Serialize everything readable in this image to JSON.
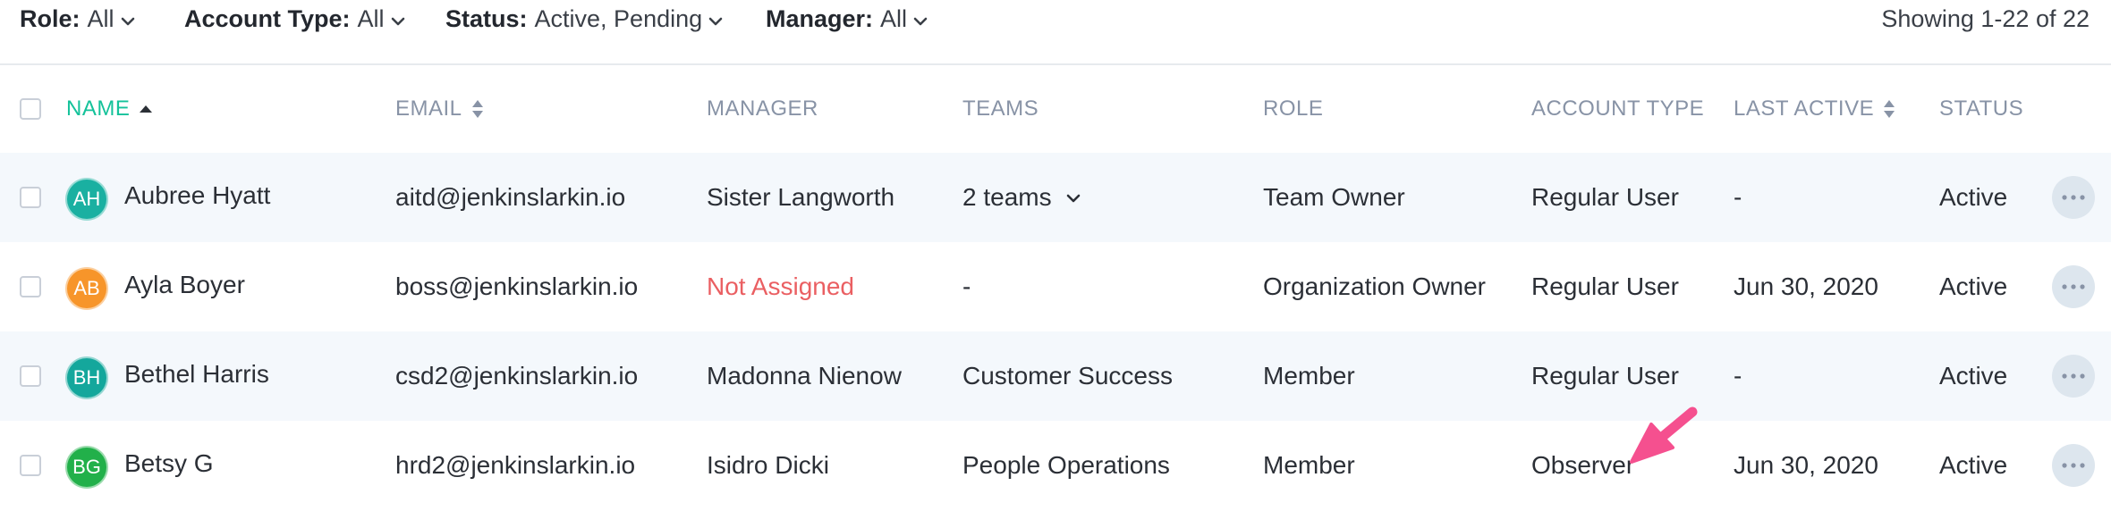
{
  "filters": [
    {
      "key": "Role:",
      "value": "All"
    },
    {
      "key": "Account Type:",
      "value": "All"
    },
    {
      "key": "Status:",
      "value": "Active, Pending"
    },
    {
      "key": "Manager:",
      "value": "All"
    }
  ],
  "showing": "Showing 1-22 of 22",
  "columns": {
    "name": "NAME",
    "email": "EMAIL",
    "manager": "MANAGER",
    "teams": "TEAMS",
    "role": "ROLE",
    "account_type": "ACCOUNT TYPE",
    "last_active": "LAST ACTIVE",
    "status": "STATUS"
  },
  "rows": [
    {
      "initials": "AH",
      "avatar_color": "#1ab0a1",
      "name": "Aubree Hyatt",
      "email": "aitd@jenkinslarkin.io",
      "manager": "Sister Langworth",
      "teams": "2 teams",
      "role": "Team Owner",
      "account_type": "Regular User",
      "last_active": "-",
      "status": "Active"
    },
    {
      "initials": "AB",
      "avatar_color": "#f7952a",
      "name": "Ayla Boyer",
      "email": "boss@jenkinslarkin.io",
      "manager": "Not Assigned",
      "teams": "-",
      "role": "Organization Owner",
      "account_type": "Regular User",
      "last_active": "Jun 30, 2020",
      "status": "Active"
    },
    {
      "initials": "BH",
      "avatar_color": "#14a79c",
      "name": "Bethel Harris",
      "email": "csd2@jenkinslarkin.io",
      "manager": "Madonna Nienow",
      "teams": "Customer Success",
      "role": "Member",
      "account_type": "Regular User",
      "last_active": "-",
      "status": "Active"
    },
    {
      "initials": "BG",
      "avatar_color": "#22b04a",
      "name": "Betsy G",
      "email": "hrd2@jenkinslarkin.io",
      "manager": "Isidro Dicki",
      "teams": "People Operations",
      "role": "Member",
      "account_type": "Observer",
      "last_active": "Jun 30, 2020",
      "status": "Active"
    }
  ],
  "colors": {
    "accent": "#14c29a",
    "warning_text": "#ea5f62",
    "arrow": "#f5508f"
  }
}
